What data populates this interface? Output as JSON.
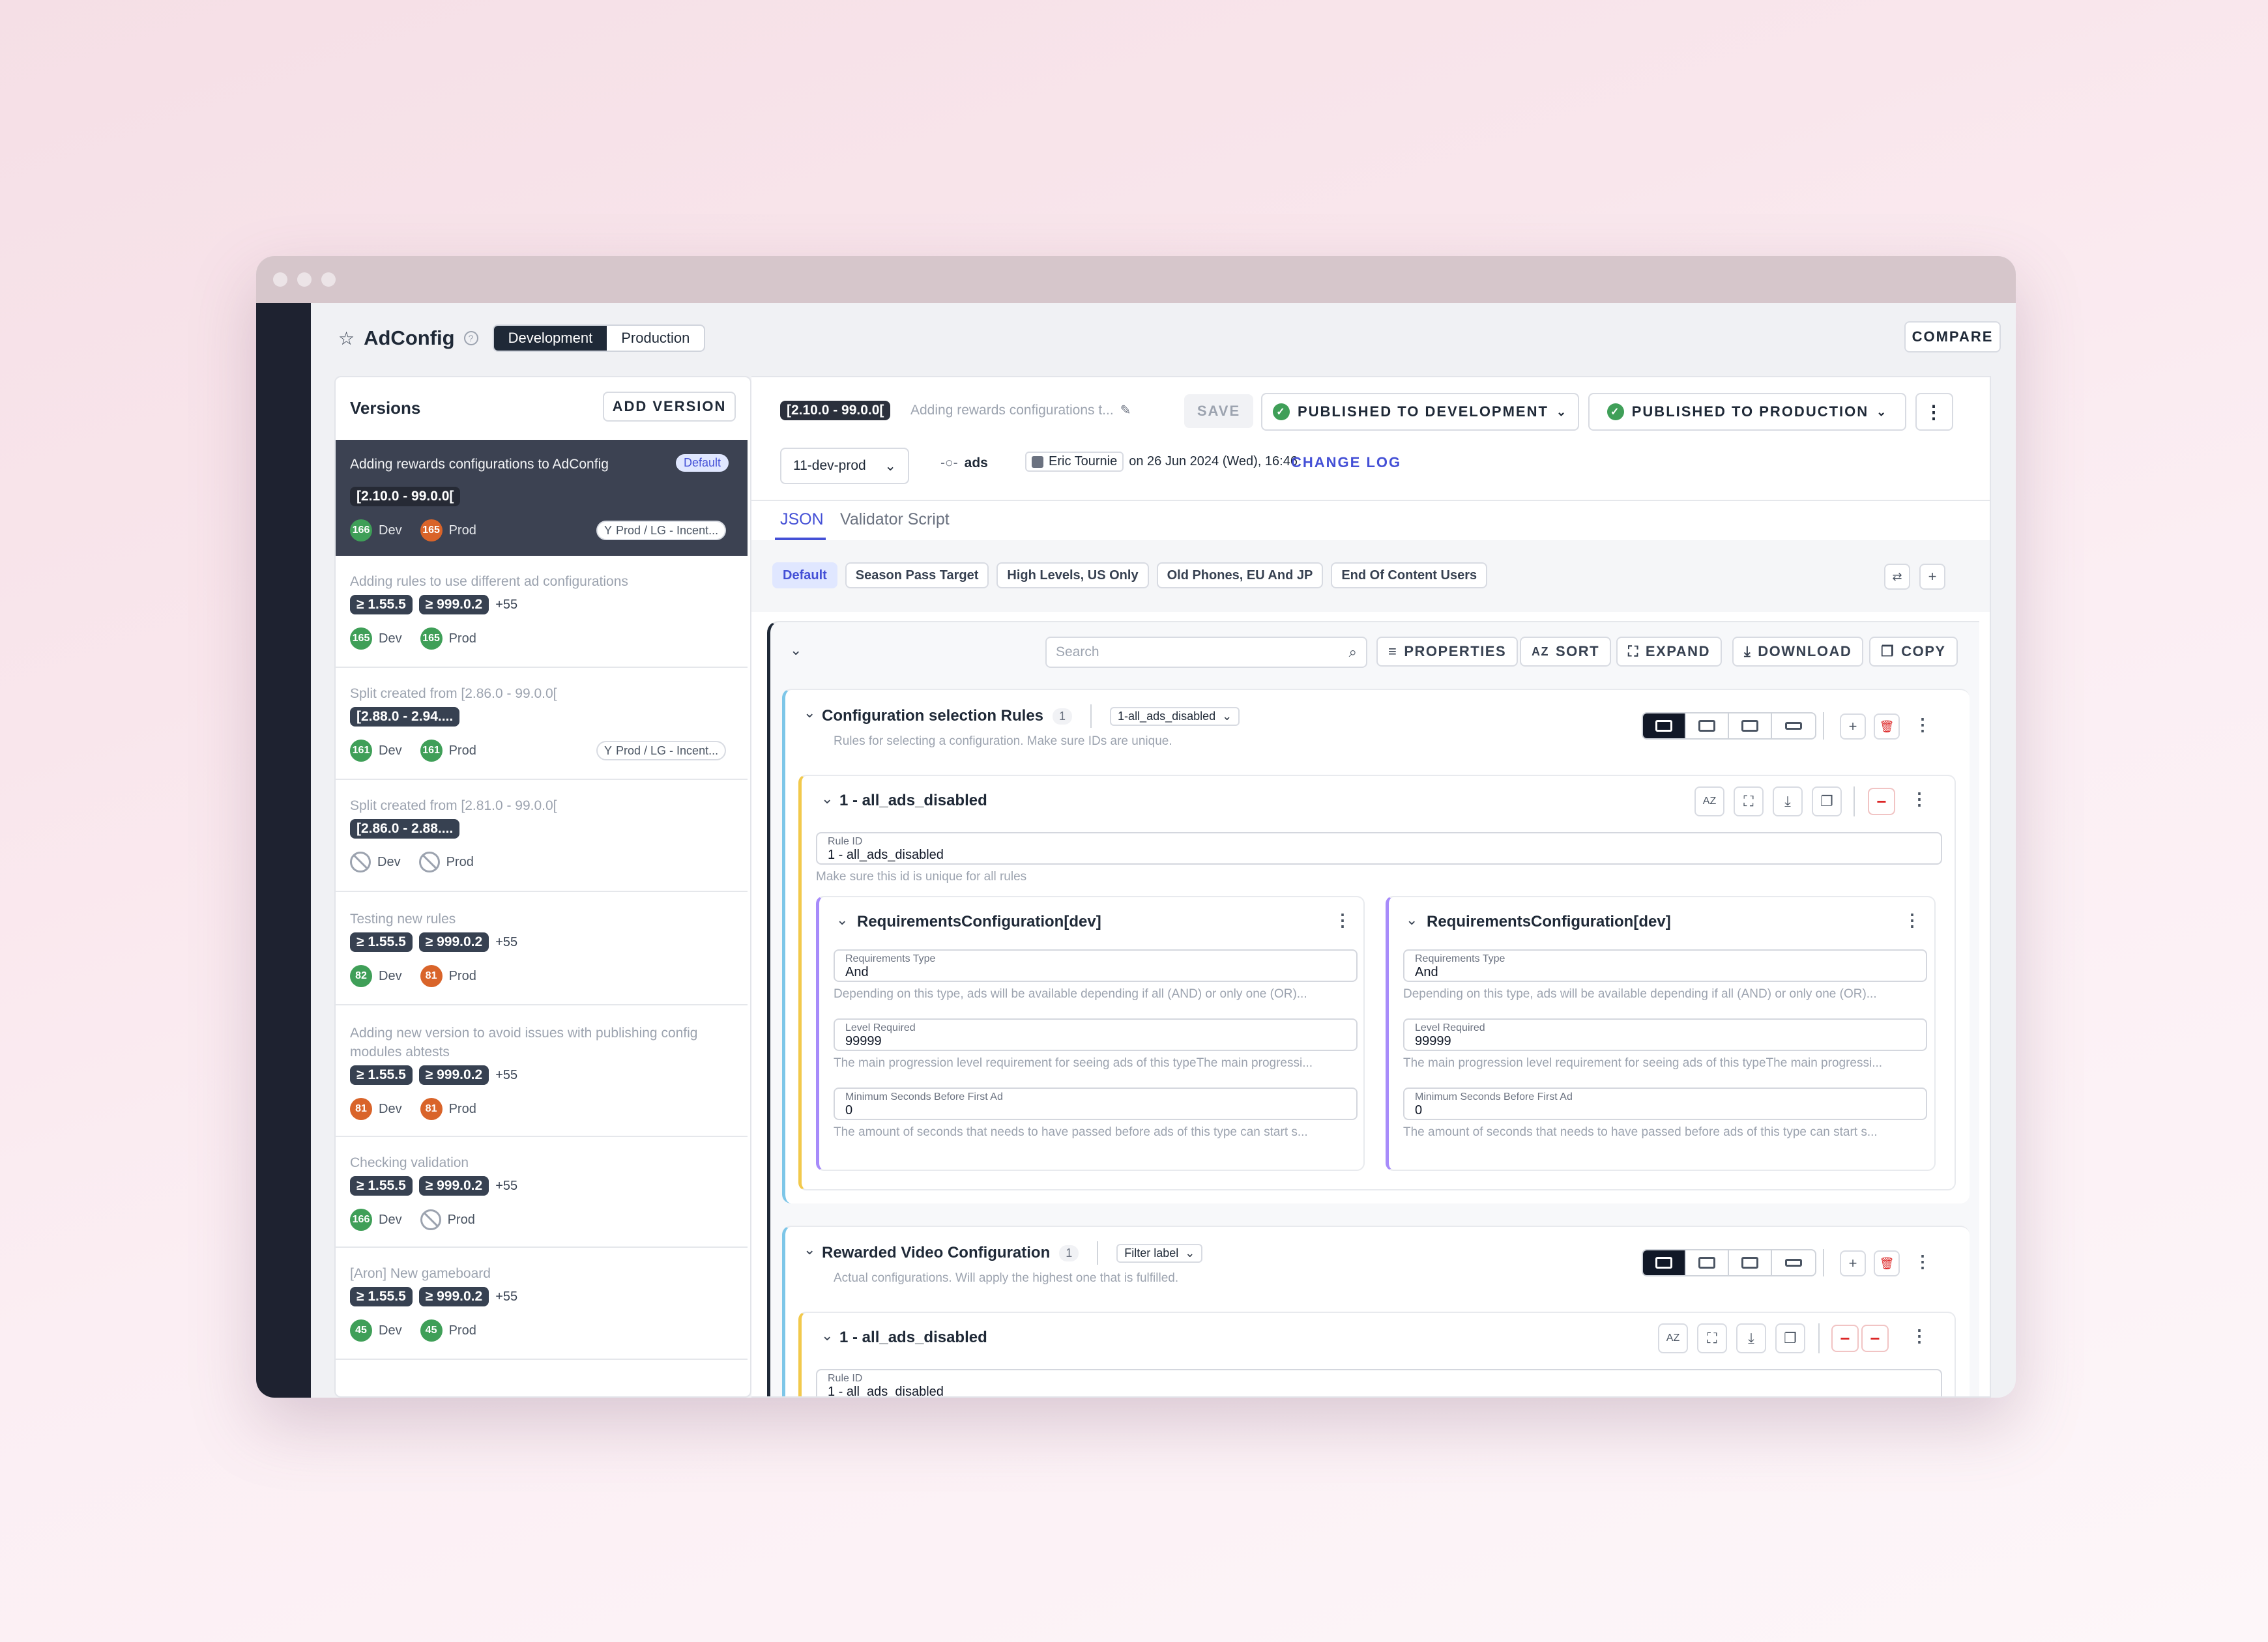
{
  "header": {
    "title": "AdConfig",
    "env_tabs": [
      "Development",
      "Production"
    ],
    "compare": "COMPARE"
  },
  "versions": {
    "title": "Versions",
    "add": "ADD VERSION",
    "items": [
      {
        "title": "Adding rewards configurations to AdConfig",
        "badge": "Default",
        "range": "[2.10.0 - 99.0.0[",
        "dev": "166",
        "prod": "165",
        "dev_label": "Dev",
        "prod_label": "Prod",
        "split": "Prod / LG - Incent..."
      },
      {
        "title": "Adding rules to use different ad configurations",
        "min": "≥ 1.55.5",
        "max": "≥ 999.0.2",
        "more": "+55",
        "dev": "165",
        "prod": "165",
        "dev_label": "Dev",
        "prod_label": "Prod"
      },
      {
        "title": "Split created from [2.86.0 - 99.0.0[",
        "range": "[2.88.0 - 2.94....",
        "dev": "161",
        "prod": "161",
        "dev_label": "Dev",
        "prod_label": "Prod",
        "split": "Prod / LG - Incent..."
      },
      {
        "title": "Split created from [2.81.0 - 99.0.0[",
        "range": "[2.86.0 - 2.88....",
        "dev_label": "Dev",
        "prod_label": "Prod"
      },
      {
        "title": "Testing new rules",
        "min": "≥ 1.55.5",
        "max": "≥ 999.0.2",
        "more": "+55",
        "dev": "82",
        "prod": "81",
        "dev_label": "Dev",
        "prod_label": "Prod"
      },
      {
        "title": "Adding new version to avoid issues with publishing config modules abtests",
        "min": "≥ 1.55.5",
        "max": "≥ 999.0.2",
        "more": "+55",
        "dev": "81",
        "prod": "81",
        "dev_label": "Dev",
        "prod_label": "Prod"
      },
      {
        "title": "Checking validation",
        "min": "≥ 1.55.5",
        "max": "≥ 999.0.2",
        "more": "+55",
        "dev": "166",
        "dev_label": "Dev",
        "prod_label": "Prod"
      },
      {
        "title": "[Aron] New gameboard",
        "min": "≥ 1.55.5",
        "max": "≥ 999.0.2",
        "more": "+55",
        "dev": "45",
        "prod": "45",
        "dev_label": "Dev",
        "prod_label": "Prod"
      }
    ]
  },
  "editor": {
    "range": "[2.10.0 - 99.0.0[",
    "desc": "Adding rewards configurations t...",
    "save": "SAVE",
    "pub_dev": "PUBLISHED TO DEVELOPMENT",
    "pub_prod": "PUBLISHED TO PRODUCTION",
    "branch": "11-dev-prod",
    "commit": "ads",
    "author": "Eric Tournie",
    "date": "on 26 Jun 2024 (Wed), 16:46",
    "changelog": "CHANGE LOG",
    "tabs": [
      "JSON",
      "Validator Script"
    ],
    "segments": [
      "Default",
      "Season Pass Target",
      "High Levels, US Only",
      "Old Phones, EU And JP",
      "End Of Content Users"
    ],
    "search_placeholder": "Search",
    "toolbar": {
      "properties": "PROPERTIES",
      "sort": "SORT",
      "expand": "EXPAND",
      "download": "DOWNLOAD",
      "copy": "COPY"
    },
    "sec1": {
      "title": "Configuration selection Rules",
      "count": "1",
      "filter": "1-all_ads_disabled",
      "desc": "Rules for selecting a configuration. Make sure IDs are unique.",
      "rule": {
        "title": "1 - all_ads_disabled",
        "id_label": "Rule ID",
        "id_value": "1 - all_ads_disabled",
        "hint": "Make sure this id is unique for all rules"
      },
      "req": {
        "title": "RequirementsConfiguration[dev]",
        "type_label": "Requirements Type",
        "type_value": "And",
        "type_hint": "Depending on this type, ads will be available depending if all (AND) or only one (OR)...",
        "level_label": "Level Required",
        "level_value": "99999",
        "level_hint": "The main progression level requirement for seeing ads of this typeThe main progressi...",
        "min_label": "Minimum Seconds Before First Ad",
        "min_value": "0",
        "min_hint": "The amount of seconds that needs to have passed before ads of this type can start s..."
      }
    },
    "sec2": {
      "title": "Rewarded Video Configuration",
      "count": "1",
      "filter": "Filter label",
      "desc": "Actual configurations. Will apply the highest one that is fulfilled.",
      "rule": {
        "title": "1 - all_ads_disabled",
        "id_label": "Rule ID",
        "id_value": "1 - all_ads_disabled"
      }
    }
  },
  "colors": {
    "dev_badge": "#3f9f58",
    "prod_badge": "#d9642a",
    "accent": "#4450d6",
    "rail": "#1e2230"
  }
}
